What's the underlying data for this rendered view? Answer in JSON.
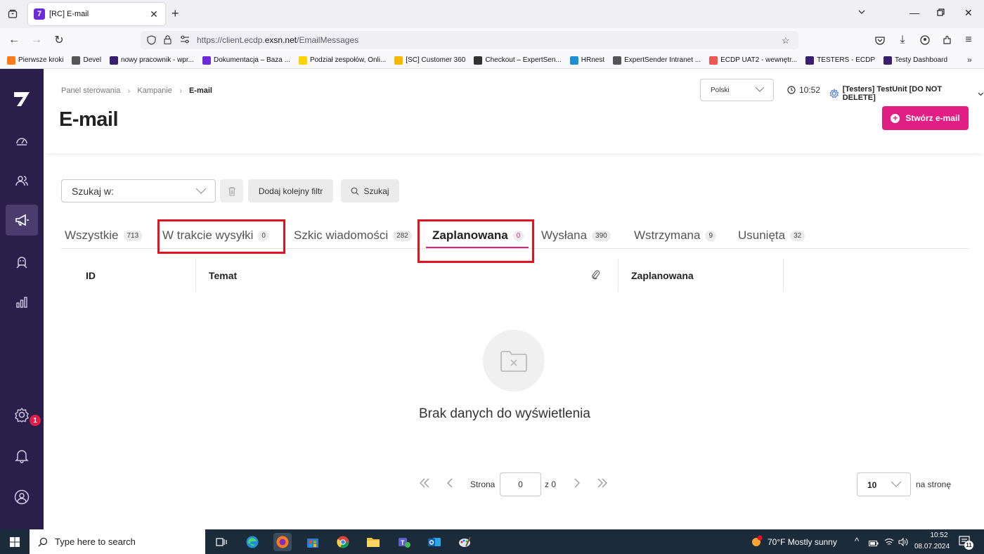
{
  "browser": {
    "tab_title": "[RC] E-mail",
    "url_prefix": "https://client.ecdp.",
    "url_domain": "exsn.net",
    "url_path": "/EmailMessages",
    "bookmarks": [
      "Pierwsze kroki",
      "Devel",
      "nowy pracownik - wpr...",
      "Dokumentacja – Baza ...",
      "Podział zespołów, Onli...",
      "[SC] Customer 360",
      "Checkout – ExpertSen...",
      "HRnest",
      "ExpertSender Intranet ...",
      "ECDP UAT2 - wewnętr...",
      "TESTERS - ECDP",
      "Testy Dashboard"
    ]
  },
  "header": {
    "breadcrumb": [
      "Panel sterowania",
      "Kampanie",
      "E-mail"
    ],
    "title": "E-mail",
    "language": "Polski",
    "time": "10:52",
    "tenant": "[Testers] TestUnit [DO NOT DELETE]",
    "create_label": "Stwórz e-mail"
  },
  "filters": {
    "search_in": "Szukaj w:",
    "add_filter": "Dodaj kolejny filtr",
    "search": "Szukaj"
  },
  "tabs": [
    {
      "label": "Wszystkie",
      "count": "713"
    },
    {
      "label": "W trakcie wysyłki",
      "count": "0"
    },
    {
      "label": "Szkic wiadomości",
      "count": "282"
    },
    {
      "label": "Zaplanowana",
      "count": "0"
    },
    {
      "label": "Wysłana",
      "count": "390"
    },
    {
      "label": "Wstrzymana",
      "count": "9"
    },
    {
      "label": "Usunięta",
      "count": "32"
    }
  ],
  "active_tab": "Zaplanowana",
  "table": {
    "columns": [
      "ID",
      "Temat",
      "Zaplanowana"
    ],
    "empty_text": "Brak danych do wyświetlenia"
  },
  "pagination": {
    "page_label": "Strona",
    "page_value": "0",
    "of_label": "z 0",
    "per_page_value": "10",
    "per_page_label": "na stronę"
  },
  "sidebar": {
    "settings_badge": "1"
  },
  "taskbar": {
    "search_placeholder": "Type here to search",
    "weather": "70°F  Mostly sunny",
    "time": "10:52",
    "date": "08.07.2024",
    "notif_count": "11"
  },
  "colors": {
    "accent": "#e01e84",
    "sidebar": "#2a1f4a",
    "highlight": "#e0141e"
  }
}
